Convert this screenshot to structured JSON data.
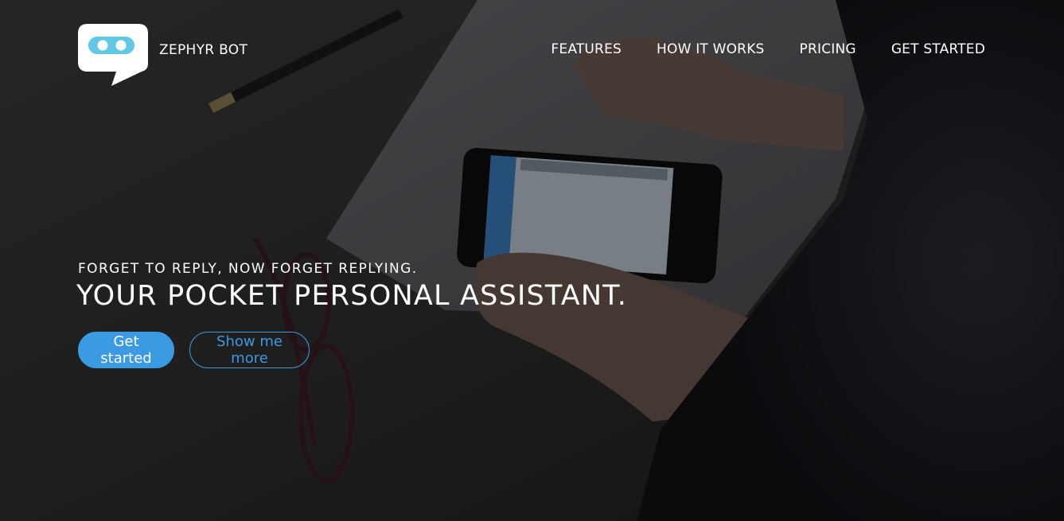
{
  "brand": {
    "name": "ZEPHYR BOT",
    "logo_icon": "chat-bot-icon"
  },
  "nav": {
    "items": [
      {
        "label": "FEATURES"
      },
      {
        "label": "HOW IT WORKS"
      },
      {
        "label": "PRICING"
      },
      {
        "label": "GET STARTED"
      }
    ]
  },
  "hero": {
    "tagline": "FORGET TO REPLY, NOW FORGET REPLYING.",
    "headline": "YOUR POCKET PERSONAL ASSISTANT.",
    "primary_cta": "Get started",
    "secondary_cta": "Show me more"
  },
  "colors": {
    "accent": "#3b9ae1",
    "text": "#ffffff",
    "logo_screen": "#63c8e6"
  }
}
